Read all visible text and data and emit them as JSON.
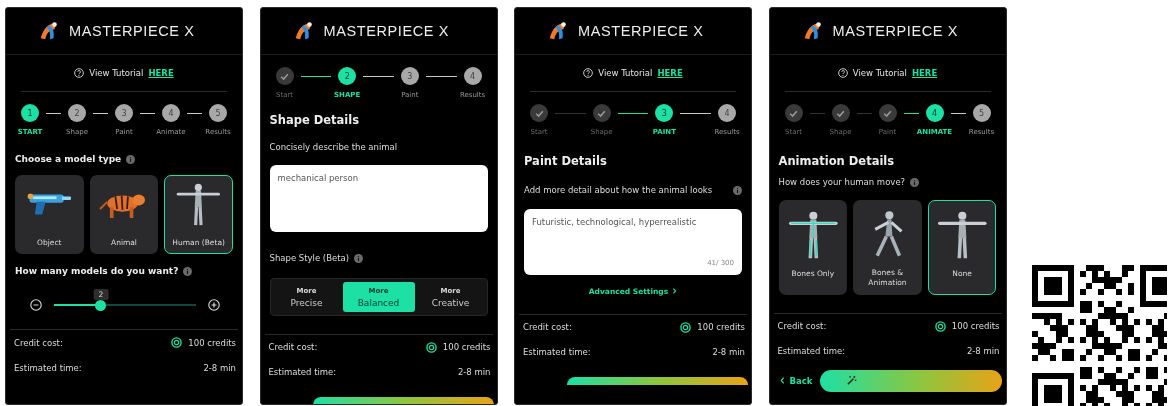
{
  "screens": [
    {
      "brand": "MASTERPIECE X",
      "tutorial": {
        "text": "View Tutorial",
        "link": "HERE"
      },
      "steps": [
        {
          "number": "1",
          "label": "START",
          "selected": true,
          "done": false
        },
        {
          "number": "2",
          "label": "Shape",
          "selected": false,
          "done": false
        },
        {
          "number": "3",
          "label": "Paint",
          "selected": false,
          "done": false
        },
        {
          "number": "4",
          "label": "Animate",
          "selected": false,
          "done": false
        },
        {
          "number": "5",
          "label": "Results",
          "selected": false,
          "done": false
        }
      ],
      "content": {
        "kind": "model_type",
        "heading": "Choose a model type",
        "cards": [
          {
            "label": "Object",
            "selected": false
          },
          {
            "label": "Animal",
            "selected": false
          },
          {
            "label": "Human (Beta)",
            "selected": true
          }
        ],
        "count_question": "How many models do you want?",
        "count_value": "2",
        "level": 0.33
      },
      "credit_label": "Credit cost:",
      "credit_value": "100 credits",
      "time_label": "Estimated time:",
      "time_value": "2-8 min"
    },
    {
      "brand": "MASTERPIECE X",
      "steps": [
        {
          "label": "Start",
          "selected": false,
          "done": true
        },
        {
          "number": "2",
          "label": "SHAPE",
          "selected": true,
          "done": false
        },
        {
          "number": "3",
          "label": "Paint",
          "selected": false,
          "done": false
        },
        {
          "number": "4",
          "label": "Results",
          "selected": false,
          "done": false
        }
      ],
      "content": {
        "kind": "shape",
        "heading": "Shape Details",
        "prompt": "Concisely describe the animal",
        "value": "mechanical person",
        "style_label": "Shape Style (Beta)",
        "options": [
          {
            "small": "More",
            "label": "Precise",
            "selected": false
          },
          {
            "small": "More",
            "label": "Balanced",
            "selected": true
          },
          {
            "small": "More",
            "label": "Creative",
            "selected": false
          }
        ]
      },
      "credit_label": "Credit cost:",
      "credit_value": "100 credits",
      "time_label": "Estimated time:",
      "time_value": "2-8 min",
      "footer": {
        "kind": "peek"
      }
    },
    {
      "brand": "MASTERPIECE X",
      "tutorial": {
        "text": "View Tutorial",
        "link": "HERE"
      },
      "steps": [
        {
          "label": "Start",
          "selected": false,
          "done": true
        },
        {
          "label": "Shape",
          "selected": false,
          "done": true
        },
        {
          "number": "3",
          "label": "PAINT",
          "selected": true,
          "done": false
        },
        {
          "number": "4",
          "label": "Results",
          "selected": false,
          "done": false
        }
      ],
      "content": {
        "kind": "paint",
        "heading": "Paint Details",
        "prompt": "Add more detail about how the animal looks",
        "value": "Futuristic, technological, hyperrealistic",
        "counter": "41/ 300",
        "link": "Advanced Settings"
      },
      "credit_label": "Credit cost:",
      "credit_value": "100 credits",
      "time_label": "Estimated time:",
      "time_value": "2-8 min",
      "footer": {
        "kind": "peek"
      }
    },
    {
      "brand": "MASTERPIECE X",
      "tutorial": {
        "text": "View Tutorial",
        "link": "HERE"
      },
      "steps": [
        {
          "label": "Start",
          "selected": false,
          "done": true
        },
        {
          "label": "Shape",
          "selected": false,
          "done": true
        },
        {
          "label": "Paint",
          "selected": false,
          "done": true
        },
        {
          "number": "4",
          "label": "ANIMATE",
          "selected": true,
          "done": false
        },
        {
          "number": "5",
          "label": "Results",
          "selected": false,
          "done": false
        }
      ],
      "content": {
        "kind": "animate",
        "heading": "Animation Details",
        "question": "How does your human move?",
        "cards": [
          {
            "label": "Bones Only",
            "selected": false
          },
          {
            "label": "Bones & Animation",
            "selected": false
          },
          {
            "label": "None",
            "selected": true
          }
        ]
      },
      "credit_label": "Credit cost:",
      "credit_value": "100 credits",
      "time_label": "Estimated time:",
      "time_value": "2-8 min",
      "footer": {
        "kind": "back_generate",
        "back": "Back"
      }
    }
  ]
}
